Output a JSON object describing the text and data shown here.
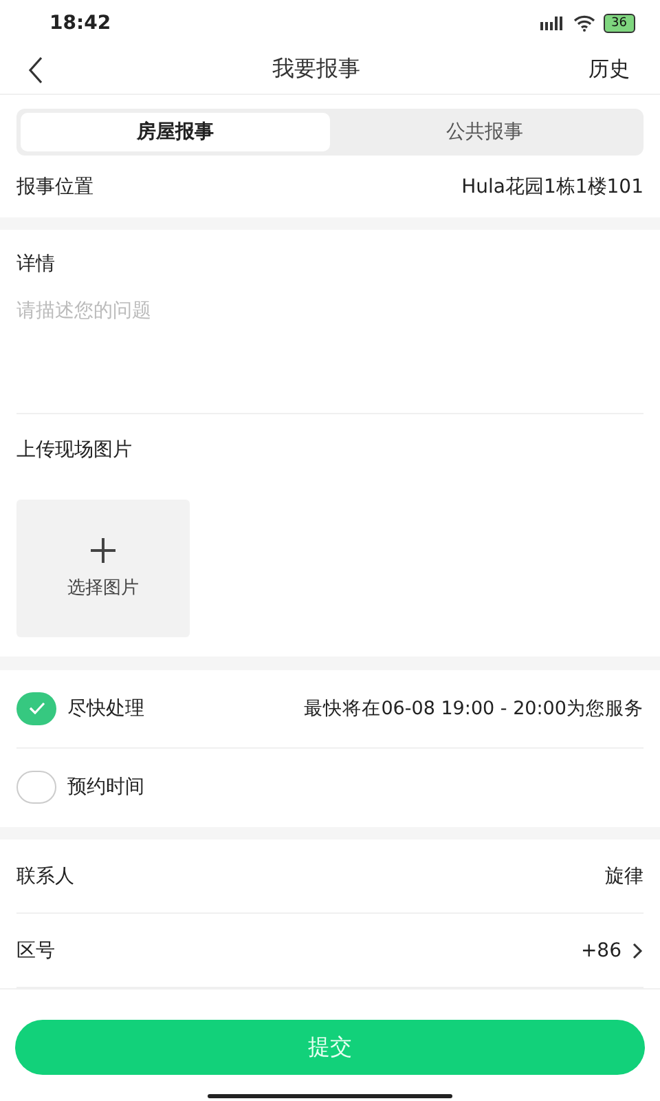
{
  "status_bar": {
    "time": "18:42",
    "battery": "36"
  },
  "nav": {
    "title": "我要报事",
    "action": "历史"
  },
  "tabs": [
    {
      "label": "房屋报事",
      "selected": true
    },
    {
      "label": "公共报事",
      "selected": false
    }
  ],
  "location": {
    "label": "报事位置",
    "value": "Hula花园1栋1楼101"
  },
  "details": {
    "label": "详情",
    "placeholder": "请描述您的问题"
  },
  "upload": {
    "label": "上传现场图片",
    "button": "选择图片"
  },
  "schedule": [
    {
      "label": "尽快处理",
      "note": "最快将在06-08 19:00 - 20:00为您服务",
      "selected": true
    },
    {
      "label": "预约时间",
      "selected": false
    }
  ],
  "contact": [
    {
      "label": "联系人",
      "value": "旋律",
      "chevron": false
    },
    {
      "label": "区号",
      "value": "+86",
      "chevron": true
    }
  ],
  "submit": "提交"
}
